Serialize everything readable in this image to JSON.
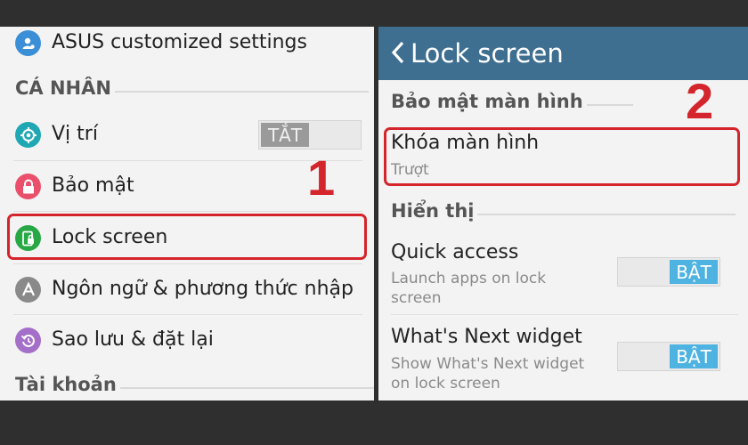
{
  "left": {
    "items": [
      {
        "label": "ASUS customized settings",
        "icon": "asus-settings-icon",
        "icon_color": "#3a8fd6"
      },
      {
        "label": "Vị trí",
        "icon": "location-icon",
        "icon_color": "#1fa8b3"
      },
      {
        "label": "Bảo mật",
        "icon": "lock-icon",
        "icon_color": "#ea4f6c"
      },
      {
        "label": "Lock screen",
        "icon": "lock-screen-icon",
        "icon_color": "#27a845"
      },
      {
        "label": "Ngôn ngữ & phương thức nhập",
        "icon": "language-icon",
        "icon_color": "#8a8a8a"
      },
      {
        "label": "Sao lưu & đặt lại",
        "icon": "backup-icon",
        "icon_color": "#a46fc9"
      }
    ],
    "sections": {
      "personal": "CÁ NHÂN",
      "account": "Tài khoản"
    },
    "location_toggle": "TẮT",
    "step_number": "1"
  },
  "right": {
    "header_title": "Lock screen",
    "section_security": "Bảo mật màn hình",
    "screen_lock": {
      "title": "Khóa màn hình",
      "subtitle": "Trượt"
    },
    "section_display": "Hiển thị",
    "quick_access": {
      "title": "Quick access",
      "subtitle": "Launch apps on lock screen",
      "toggle": "BẬT"
    },
    "whats_next": {
      "title": "What's Next widget",
      "subtitle": "Show What's Next widget on lock screen",
      "toggle": "BẬT"
    },
    "step_number": "2"
  },
  "colors": {
    "highlight": "#d4242c",
    "header": "#3e6e90",
    "toggle_on": "#4fb3e2",
    "toggle_off": "#9a9a9a"
  }
}
